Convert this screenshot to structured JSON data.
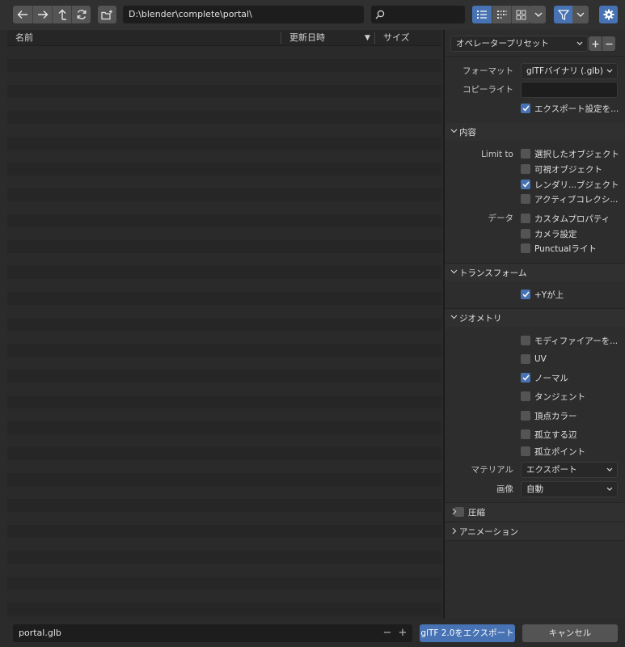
{
  "toolbar": {
    "path": "D:\\blender\\complete\\portal\\",
    "search_value": ""
  },
  "file_list": {
    "columns": [
      "名前",
      "更新日時",
      "サイズ"
    ],
    "sort_indicator": "▼"
  },
  "options": {
    "preset": {
      "value": "オペレータープリセット"
    },
    "format": {
      "label": "フォーマット",
      "value": "glTFバイナリ (.glb)"
    },
    "copyright": {
      "label": "コピーライト",
      "value": ""
    },
    "remember_settings": {
      "label": "エクスポート設定を...",
      "checked": true
    },
    "sections": {
      "include": "内容",
      "transform": "トランスフォーム",
      "geometry": "ジオメトリ",
      "compression": "圧縮",
      "animation": "アニメーション"
    },
    "limit_to": {
      "label": "Limit to",
      "items": [
        {
          "label": "選択したオブジェクト",
          "checked": false
        },
        {
          "label": "可視オブジェクト",
          "checked": false
        },
        {
          "label": "レンダリ...ブジェクト",
          "checked": true
        },
        {
          "label": "アクティブコレクシ...",
          "checked": false
        }
      ]
    },
    "data": {
      "label": "データ",
      "items": [
        {
          "label": "カスタムプロパティ",
          "checked": false
        },
        {
          "label": "カメラ設定",
          "checked": false
        },
        {
          "label": "Punctualライト",
          "checked": false
        }
      ]
    },
    "y_up": {
      "label": "+Yが上",
      "checked": true
    },
    "geometry_items": [
      {
        "label": "モディファイアーを...",
        "checked": false
      },
      {
        "label": "UV",
        "checked": false
      },
      {
        "label": "ノーマル",
        "checked": true
      },
      {
        "label": "タンジェント",
        "checked": false
      },
      {
        "label": "頂点カラー",
        "checked": false
      },
      {
        "label": "孤立する辺",
        "checked": false
      },
      {
        "label": "孤立ポイント",
        "checked": false
      }
    ],
    "material": {
      "label": "マテリアル",
      "value": "エクスポート"
    },
    "images": {
      "label": "画像",
      "value": "自動"
    },
    "compression_checked": false
  },
  "bottom": {
    "filename": "portal.glb",
    "minus": "−",
    "plus": "+",
    "export_label": "glTF 2.0をエクスポート",
    "cancel_label": "キャンセル"
  },
  "colors": {
    "accent": "#4772b3",
    "button": "#545454",
    "field": "#1d1d1d",
    "panel": "#2d2d2d"
  }
}
